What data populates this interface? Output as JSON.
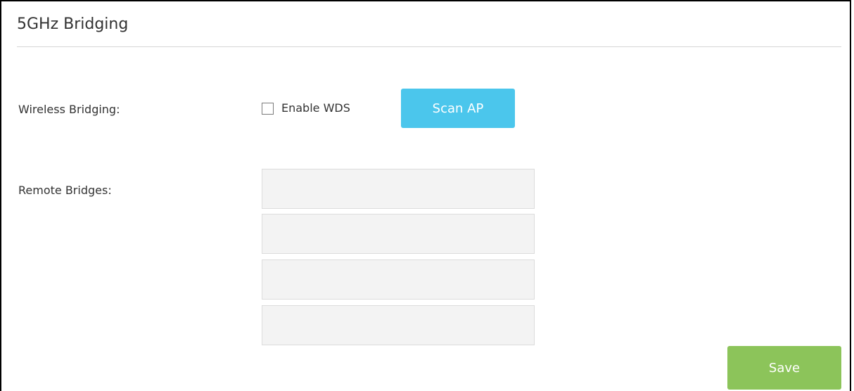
{
  "page": {
    "title": "5GHz Bridging"
  },
  "wireless_bridging": {
    "label": "Wireless Bridging:",
    "checkbox_label": "Enable WDS",
    "checked": false,
    "scan_button_label": "Scan AP"
  },
  "remote_bridges": {
    "label": "Remote Bridges:",
    "entries": [
      {
        "value": ""
      },
      {
        "value": ""
      },
      {
        "value": ""
      },
      {
        "value": ""
      }
    ]
  },
  "actions": {
    "save_label": "Save"
  },
  "colors": {
    "scan_button": "#4bc6ec",
    "save_button": "#8cc45a",
    "input_background": "#f3f3f3",
    "text": "#333333"
  }
}
